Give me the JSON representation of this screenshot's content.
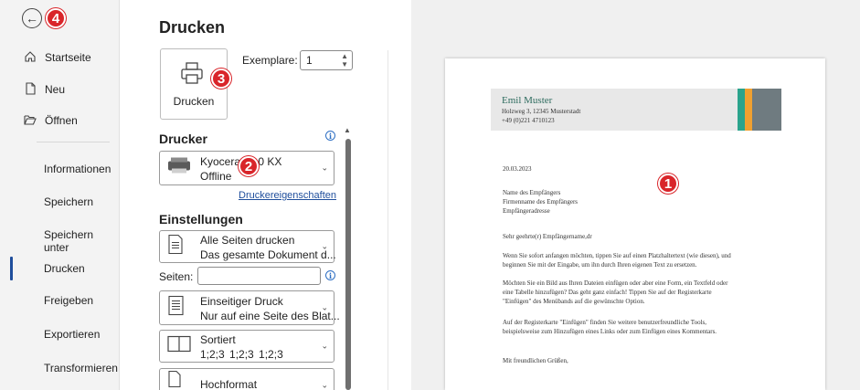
{
  "sidebar": {
    "nav_items": [
      {
        "label": "Startseite",
        "icon": "home-icon"
      },
      {
        "label": "Neu",
        "icon": "new-document-icon"
      },
      {
        "label": "Öffnen",
        "icon": "open-folder-icon"
      }
    ],
    "sub_items": [
      "Informationen",
      "Speichern",
      "Speichern unter",
      "Drucken",
      "Freigeben",
      "Exportieren",
      "Transformieren"
    ],
    "active": "Drucken"
  },
  "main": {
    "title": "Drucken",
    "print_button_label": "Drucken",
    "copies_label": "Exemplare:",
    "copies_value": "1",
    "printer_section_title": "Drucker",
    "printer_name": "Kyocera F...0 KX",
    "printer_status": "Offline",
    "printer_properties_link": "Druckereigenschaften",
    "settings_section_title": "Einstellungen",
    "settings": [
      {
        "line1": "Alle Seiten drucken",
        "line2": "Das gesamte Dokument d...",
        "icon": "pages-icon"
      },
      {
        "line1": "Einseitiger Druck",
        "line2": "Nur auf eine Seite des Blat...",
        "icon": "single-sided-icon"
      },
      {
        "line1": "Sortiert",
        "line2": "1;2;3   1;2;3   1;2;3",
        "icon": "collated-icon"
      },
      {
        "line1": "Hochformat",
        "line2": "",
        "icon": "portrait-icon"
      }
    ],
    "pages_label": "Seiten:",
    "pages_value": ""
  },
  "badges": [
    "1",
    "2",
    "3",
    "4"
  ],
  "preview": {
    "sender_name": "Emil Muster",
    "sender_address": "Holzweg 3, 12345 Musterstadt",
    "sender_phone": "+49 (0)221 4710123",
    "date": "20.03.2023",
    "recipient_lines": [
      "Name des Empfängers",
      "Firmenname des Empfängers",
      "Empfängeradresse"
    ],
    "salutation": "Sehr geehrte(r) Empfängername,dr",
    "paragraphs": [
      [
        "Wenn Sie sofort anfangen möchten, tippen Sie auf einen Platzhaltertext (wie diesen), und",
        "beginnen Sie mit der Eingabe, um ihn durch Ihren eigenen Text zu ersetzen."
      ],
      [
        "Möchten Sie ein Bild aus Ihren Dateien einfügen oder aber eine Form, ein Textfeld oder",
        "eine Tabelle hinzufügen? Das geht ganz einfach! Tippen Sie auf der Registerkarte",
        "\"Einfügen\" des Menübands auf die gewünschte Option."
      ],
      [
        "Auf der Registerkarte \"Einfügen\" finden Sie weitere benutzerfreundliche Tools,",
        "beispielsweise zum Hinzufügen eines Links oder zum Einfügen eines Kommentars."
      ]
    ],
    "closing": "Mit freundlichen Grüßen,"
  },
  "colors": {
    "accent": "#1f4e9c",
    "badge": "#d9252a",
    "stripe_teal": "#2aa38c",
    "stripe_orange": "#f0a030",
    "stripe_gray": "#6f7b80",
    "name_green": "#2d6b5e"
  }
}
